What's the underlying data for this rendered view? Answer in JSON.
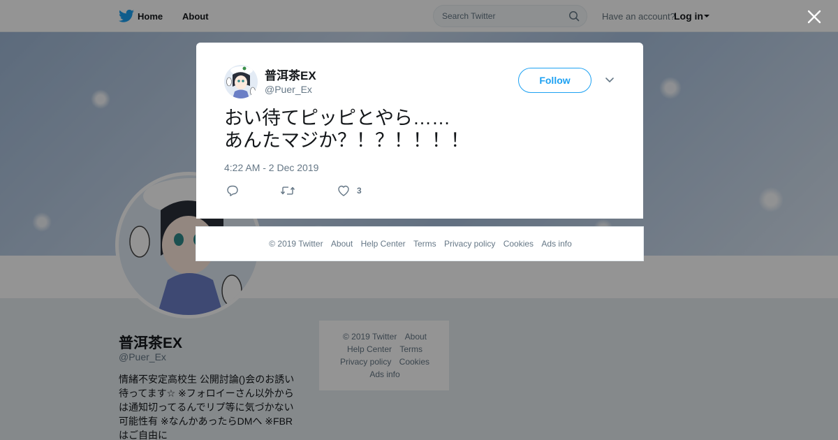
{
  "nav": {
    "home": "Home",
    "about": "About",
    "search_placeholder": "Search Twitter",
    "have_account": "Have an account?",
    "login": "Log in"
  },
  "profile": {
    "name": "普洱茶EX",
    "handle": "@Puer_Ex",
    "bio": "情緒不安定高校生 公開討論()会のお誘い\n待ってます☆ ※フォロイーさん以外から\nは通知切ってるんでリプ等に気づかない\n可能性有 ※なんかあったらDMへ ※FBR\nはご自由に"
  },
  "side_footer": {
    "copyright": "© 2019 Twitter",
    "about": "About",
    "help": "Help Center",
    "terms": "Terms",
    "privacy": "Privacy policy",
    "cookies": "Cookies",
    "ads": "Ads info"
  },
  "tweet": {
    "name": "普洱茶EX",
    "handle": "@Puer_Ex",
    "follow_label": "Follow",
    "text": "おい待てピッピとやら……\nあんたマジか？！？！！！！",
    "timestamp": "4:22 AM - 2 Dec 2019",
    "like_count": "3"
  },
  "modal_footer": {
    "copyright": "© 2019 Twitter",
    "about": "About",
    "help": "Help Center",
    "terms": "Terms",
    "privacy": "Privacy policy",
    "cookies": "Cookies",
    "ads": "Ads info"
  },
  "colors": {
    "brand": "#1da1f2",
    "secondary_text": "#657786"
  }
}
